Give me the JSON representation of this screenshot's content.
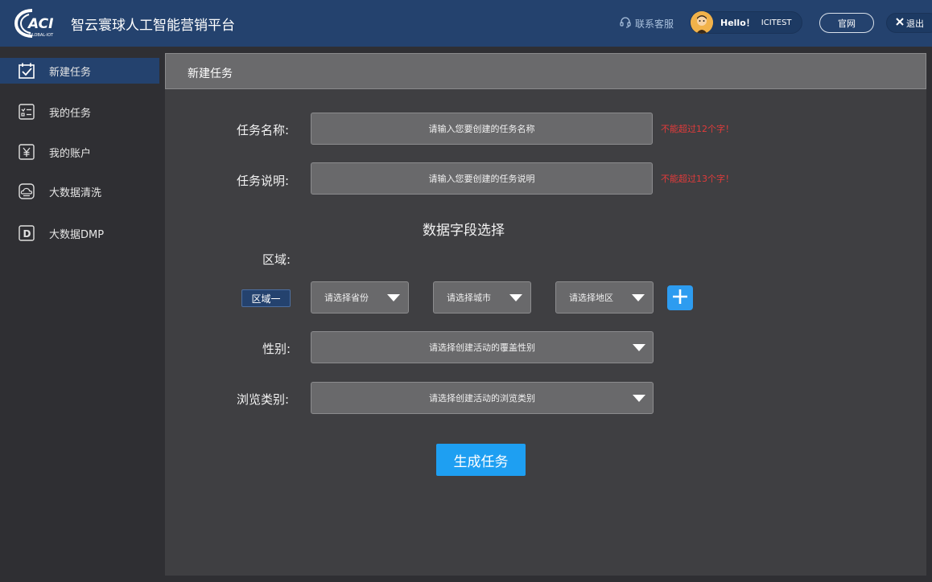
{
  "header": {
    "title": "智云寰球人工智能营销平台",
    "support_label": "联系客服",
    "hello": "Hello！",
    "username": "ICITEST",
    "site_label": "官网",
    "logout_label": "退出",
    "brand_color": "#24426e"
  },
  "sidebar": {
    "items": [
      {
        "label": "新建任务",
        "icon": "calendar-check-icon",
        "active": true
      },
      {
        "label": "我的任务",
        "icon": "task-list-icon",
        "active": false
      },
      {
        "label": "我的账户",
        "icon": "yuan-icon",
        "active": false
      },
      {
        "label": "大数据清洗",
        "icon": "cloud-icon",
        "active": false
      },
      {
        "label": "大数据DMP",
        "icon": "letter-d-icon",
        "active": false
      }
    ]
  },
  "panel": {
    "title": "新建任务",
    "task_name": {
      "label": "任务名称:",
      "placeholder": "请输入您要创建的任务名称",
      "hint": "不能超过12个字！"
    },
    "task_desc": {
      "label": "任务说明:",
      "placeholder": "请输入您要创建的任务说明",
      "hint": "不能超过13个字！"
    },
    "section_title": "数据字段选择",
    "region": {
      "label": "区域:",
      "tag": "区域一",
      "province_placeholder": "请选择省份",
      "city_placeholder": "请选择城市",
      "district_placeholder": "请选择地区"
    },
    "gender": {
      "label": "性别:",
      "placeholder": "请选择创建活动的覆盖性别"
    },
    "browse": {
      "label": "浏览类别:",
      "placeholder": "请选择创建活动的浏览类别"
    },
    "submit_label": "生成任务",
    "accent_color": "#1e9ff2",
    "hint_color": "#e23b3b"
  }
}
